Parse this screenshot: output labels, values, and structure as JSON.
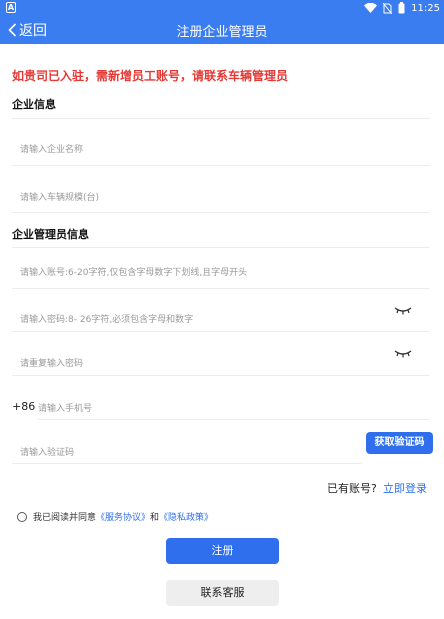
{
  "status_bar": {
    "app_icon_letter": "A",
    "time": "11:25"
  },
  "nav": {
    "back_label": "返回",
    "title": "注册企业管理员"
  },
  "notice": "如贵司已入驻，需新增员工账号，请联系车辆管理员",
  "company_section": {
    "title": "企业信息",
    "name_placeholder": "请输入企业名称",
    "fleet_placeholder": "请输入车辆规模(台)"
  },
  "admin_section": {
    "title": "企业管理员信息",
    "account_placeholder": "请输入账号:6-20字符,仅包含字母数字下划线,且字母开头",
    "password_placeholder": "请输入密码:8- 26字符,必须包含字母和数字",
    "confirm_placeholder": "请重复输入密码",
    "phone_prefix": "+86",
    "phone_placeholder": "请输入手机号",
    "code_placeholder": "请输入验证码",
    "get_code_label": "获取验证码"
  },
  "login": {
    "prompt": "已有账号?",
    "link": "立即登录"
  },
  "agreement": {
    "prefix": "我已阅读并同意",
    "service_link": "《服务协议》",
    "and": "和",
    "privacy_link": "《隐私政策》"
  },
  "buttons": {
    "register": "注册",
    "contact": "联系客服"
  },
  "colors": {
    "primary": "#2f6fed",
    "header": "#3a7df0",
    "notice": "#e53935"
  }
}
